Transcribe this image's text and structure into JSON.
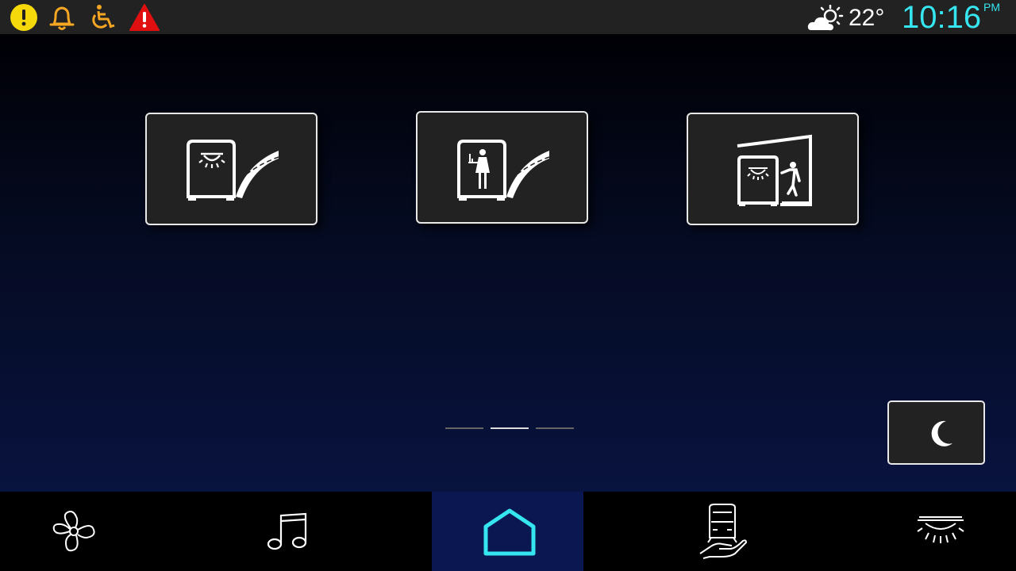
{
  "status": {
    "alerts": [
      {
        "icon": "warning-circle-icon",
        "color": "#f5d90a"
      },
      {
        "icon": "bell-icon",
        "color": "#f5a623"
      },
      {
        "icon": "wheelchair-icon",
        "color": "#f5a623"
      },
      {
        "icon": "alert-triangle-icon",
        "color": "#e01010"
      }
    ],
    "weather_icon": "partly-cloudy-icon",
    "temperature": "22°",
    "time": "10:16",
    "ampm": "PM",
    "accent": "#35e6f0"
  },
  "tiles": [
    {
      "icon": "cabin-light-platform-icon"
    },
    {
      "icon": "cabin-attendant-platform-icon"
    },
    {
      "icon": "cabin-light-boarding-icon"
    }
  ],
  "pager": {
    "pages": 3,
    "active": 2
  },
  "night_mode": {
    "icon": "moon-icon"
  },
  "nav": [
    {
      "icon": "fan-icon"
    },
    {
      "icon": "music-note-icon"
    },
    {
      "icon": "home-icon",
      "active": true
    },
    {
      "icon": "train-service-icon"
    },
    {
      "icon": "ceiling-light-icon"
    }
  ]
}
